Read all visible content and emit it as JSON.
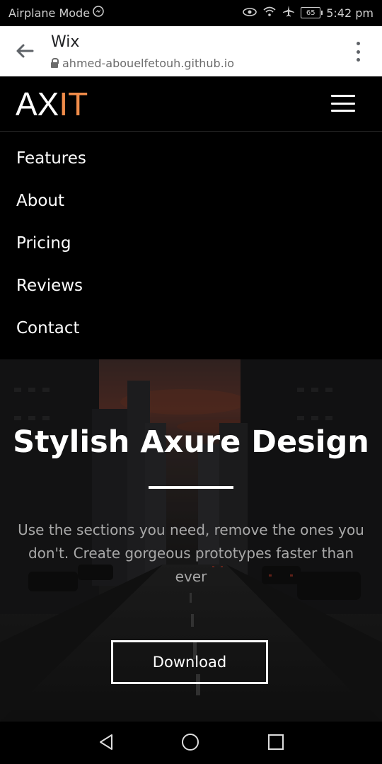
{
  "status_bar": {
    "left_text": "Airplane Mode",
    "battery": "65",
    "time": "5:42 pm"
  },
  "browser": {
    "title": "Wix",
    "url": "ahmed-abouelfetouh.github.io"
  },
  "header": {
    "logo_white": "AX",
    "logo_accent": "IT",
    "accent_color": "#f08c4a"
  },
  "menu": {
    "items": [
      "Features",
      "About",
      "Pricing",
      "Reviews",
      "Contact"
    ]
  },
  "hero": {
    "title": "Stylish Axure Design",
    "subtitle": "Use the sections you need, remove the ones you don't. Create gorgeous prototypes faster than ever",
    "button_label": "Download"
  }
}
